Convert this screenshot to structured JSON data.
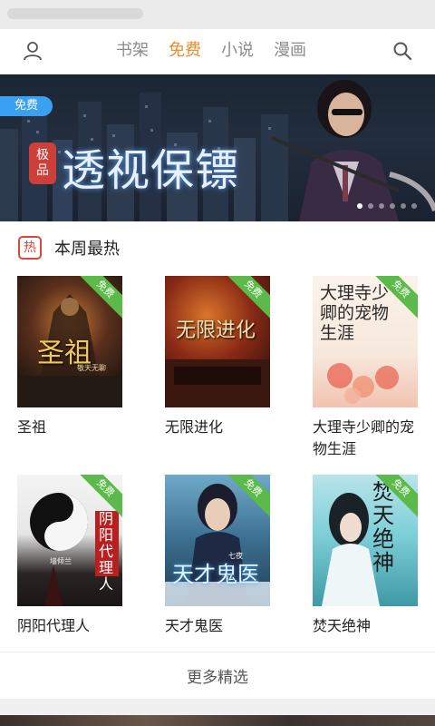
{
  "header": {
    "tabs": [
      {
        "label": "书架",
        "active": false
      },
      {
        "label": "免费",
        "active": true
      },
      {
        "label": "小说",
        "active": false
      },
      {
        "label": "漫画",
        "active": false
      }
    ],
    "profile_icon": "user-icon",
    "search_icon": "search-icon",
    "active_color": "#f08a2a"
  },
  "banner": {
    "tag": "免费",
    "category": "极品",
    "title": "透视保镖",
    "slides_total": 6,
    "slide_current": 1
  },
  "section": {
    "icon_text": "热",
    "title": "本周最热",
    "free_label": "免费"
  },
  "books": [
    {
      "title": "圣祖",
      "cover_text": "圣祖",
      "cover_author": "敬天无聊"
    },
    {
      "title": "无限进化",
      "cover_text": "无限进化",
      "cover_author": ""
    },
    {
      "title": "大理寺少卿的宠物生涯",
      "cover_text": "大理寺少卿的宠物生涯",
      "cover_author": ""
    },
    {
      "title": "阴阳代理人",
      "cover_text": "阴阳 代理人",
      "cover_author": "墙倾兰"
    },
    {
      "title": "天才鬼医",
      "cover_text": "天才鬼医",
      "cover_author": "七夜"
    },
    {
      "title": "焚天绝神",
      "cover_text": "焚天绝神",
      "cover_author": ""
    }
  ],
  "more": {
    "label": "更多精选"
  }
}
